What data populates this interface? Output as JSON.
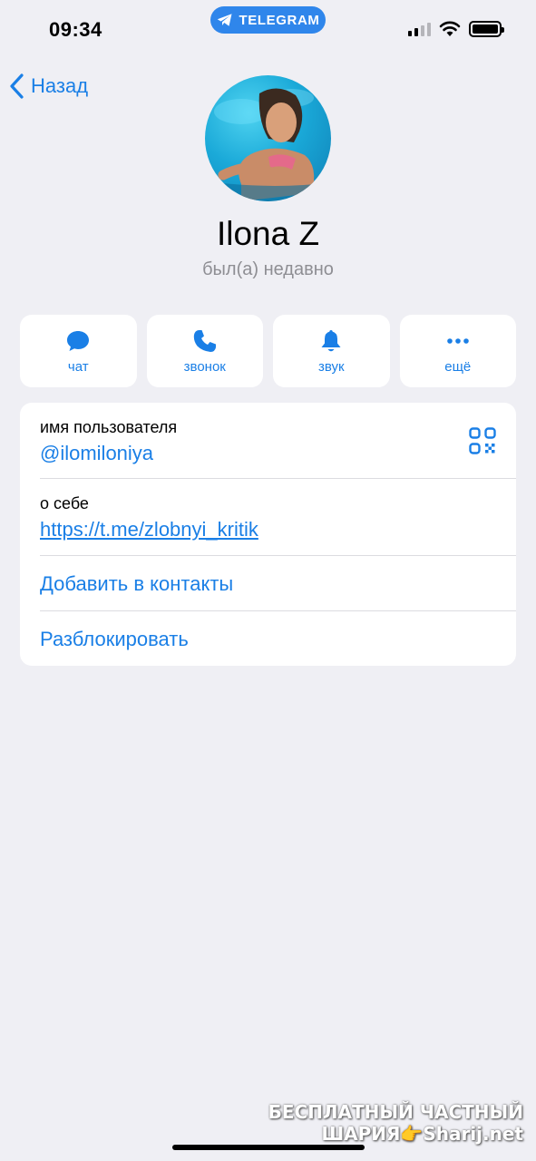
{
  "status_bar": {
    "time": "09:34",
    "app_pill": "TELEGRAM",
    "icons": [
      "cellular-signal-icon",
      "wifi-icon",
      "battery-icon"
    ]
  },
  "nav": {
    "back_label": "Назад"
  },
  "profile": {
    "name": "Ilona Z",
    "status": "был(а) недавно"
  },
  "actions": [
    {
      "label": "чат",
      "icon": "chat-bubble-icon"
    },
    {
      "label": "звонок",
      "icon": "phone-icon"
    },
    {
      "label": "звук",
      "icon": "bell-icon"
    },
    {
      "label": "ещё",
      "icon": "more-dots-icon"
    }
  ],
  "info": {
    "username_label": "имя пользователя",
    "username_value": "@ilomiloniya",
    "about_label": "о себе",
    "about_value": "https://t.me/zlobnyi_kritik",
    "add_contact": "Добавить в контакты",
    "unblock": "Разблокировать"
  },
  "watermark": {
    "line1": "БЕСПЛАТНЫЙ ЧАСТНЫЙ",
    "line2": "ШАРИЯ👉Sharij.net"
  },
  "colors": {
    "accent": "#1a7fe6",
    "background": "#efeff4",
    "card": "#ffffff",
    "secondary_text": "#8e8e93",
    "telegram_pill": "#2f86eb"
  }
}
